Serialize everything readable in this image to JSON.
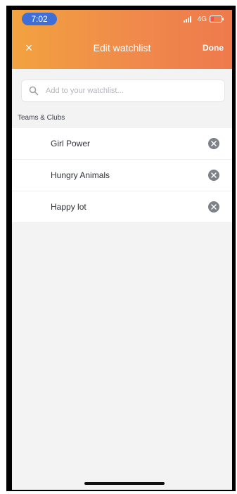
{
  "status": {
    "time": "7:02",
    "network": "4G"
  },
  "header": {
    "title": "Edit watchlist",
    "close_label": "×",
    "done_label": "Done"
  },
  "search": {
    "placeholder": "Add to your watchlist..."
  },
  "section": {
    "title": "Teams & Clubs"
  },
  "items": [
    {
      "label": "Girl Power"
    },
    {
      "label": "Hungry Animals"
    },
    {
      "label": "Happy lot"
    }
  ],
  "colors": {
    "header_start": "#f2a23f",
    "header_end": "#ee7a4c",
    "time_pill": "#3f6fd6",
    "background": "#f3f3f4"
  }
}
